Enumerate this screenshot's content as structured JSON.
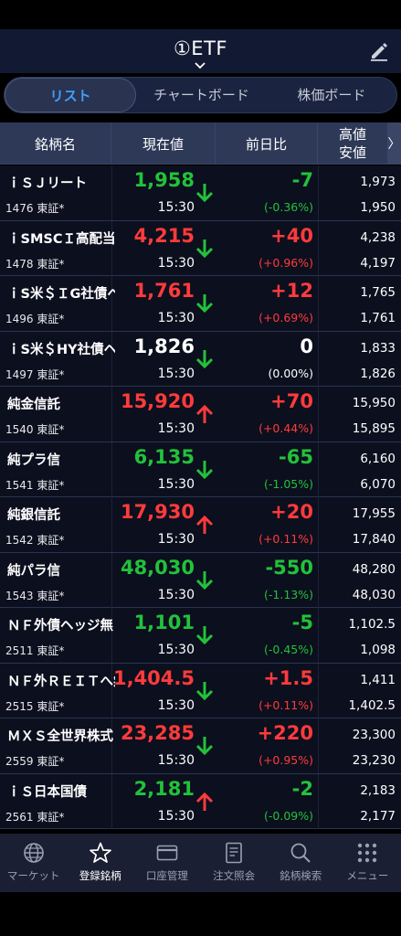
{
  "header": {
    "title": "①ETF"
  },
  "tabs": [
    {
      "label": "リスト",
      "active": true
    },
    {
      "label": "チャートボード",
      "active": false
    },
    {
      "label": "株価ボード",
      "active": false
    }
  ],
  "columns": {
    "name": "銘柄名",
    "price": "現在値",
    "change": "前日比",
    "high": "高値",
    "low": "安値",
    "more": "〉"
  },
  "rows": [
    {
      "name": "ｉＳＪリート",
      "code": "1476 東証*",
      "price": "1,958",
      "time": "15:30",
      "dir": "down",
      "change": "-7",
      "pct": "(-0.36%)",
      "high": "1,973",
      "low": "1,950"
    },
    {
      "name": "ｉSMSCＩ高配当",
      "code": "1478 東証*",
      "price": "4,215",
      "time": "15:30",
      "dir": "up",
      "change": "+40",
      "pct": "(+0.96%)",
      "high": "4,238",
      "low": "4,197"
    },
    {
      "name": "ｉS米＄ＩG社債ヘジ",
      "code": "1496 東証*",
      "price": "1,761",
      "time": "15:30",
      "dir": "up",
      "change": "+12",
      "pct": "(+0.69%)",
      "high": "1,765",
      "low": "1,761"
    },
    {
      "name": "ｉS米＄HY社債ヘジ",
      "code": "1497 東証*",
      "price": "1,826",
      "time": "15:30",
      "dir": "flat",
      "change": "0",
      "pct": "(0.00%)",
      "high": "1,833",
      "low": "1,826"
    },
    {
      "name": "純金信託",
      "code": "1540 東証*",
      "price": "15,920",
      "time": "15:30",
      "dir": "up",
      "change": "+70",
      "pct": "(+0.44%)",
      "high": "15,950",
      "low": "15,895"
    },
    {
      "name": "純プラ信",
      "code": "1541 東証*",
      "price": "6,135",
      "time": "15:30",
      "dir": "down",
      "change": "-65",
      "pct": "(-1.05%)",
      "high": "6,160",
      "low": "6,070"
    },
    {
      "name": "純銀信託",
      "code": "1542 東証*",
      "price": "17,930",
      "time": "15:30",
      "dir": "up",
      "change": "+20",
      "pct": "(+0.11%)",
      "high": "17,955",
      "low": "17,840"
    },
    {
      "name": "純パラ信",
      "code": "1543 東証*",
      "price": "48,030",
      "time": "15:30",
      "dir": "down",
      "change": "-550",
      "pct": "(-1.13%)",
      "high": "48,280",
      "low": "48,030"
    },
    {
      "name": "ＮＦ外債ヘッジ無",
      "code": "2511 東証*",
      "price": "1,101",
      "time": "15:30",
      "dir": "down",
      "change": "-5",
      "pct": "(-0.45%)",
      "high": "1,102.5",
      "low": "1,098"
    },
    {
      "name": "ＮＦ外ＲＥＩＴへ無",
      "code": "2515 東証*",
      "price": "1,404.5",
      "time": "15:30",
      "dir": "up",
      "change": "+1.5",
      "pct": "(+0.11%)",
      "high": "1,411",
      "low": "1,402.5"
    },
    {
      "name": "ＭＸＳ全世界株式",
      "code": "2559 東証*",
      "price": "23,285",
      "time": "15:30",
      "dir": "up",
      "change": "+220",
      "pct": "(+0.95%)",
      "high": "23,300",
      "low": "23,230"
    },
    {
      "name": "ｉＳ日本国債",
      "code": "2561 東証*",
      "price": "2,181",
      "time": "15:30",
      "dir": "down",
      "change": "-2",
      "pct": "(-0.09%)",
      "high": "2,183",
      "low": "2,177"
    }
  ],
  "price_colors": [
    "down",
    "up",
    "up",
    "flat",
    "up",
    "down",
    "up",
    "down",
    "down",
    "up",
    "up",
    "down"
  ],
  "arrows": [
    "down",
    "down",
    "down",
    "down",
    "up",
    "down",
    "up",
    "down",
    "down",
    "down",
    "down",
    "up"
  ],
  "nav": [
    {
      "label": "マーケット",
      "icon": "globe-icon",
      "active": false
    },
    {
      "label": "登録銘柄",
      "icon": "star-icon",
      "active": true
    },
    {
      "label": "口座管理",
      "icon": "card-icon",
      "active": false
    },
    {
      "label": "注文照会",
      "icon": "document-icon",
      "active": false
    },
    {
      "label": "銘柄検索",
      "icon": "search-icon",
      "active": false
    },
    {
      "label": "メニュー",
      "icon": "grid-icon",
      "active": false
    }
  ],
  "colors": {
    "up": "#ff3b3b",
    "down": "#22c23a",
    "flat": "#ffffff",
    "accent": "#3fa0ff"
  }
}
